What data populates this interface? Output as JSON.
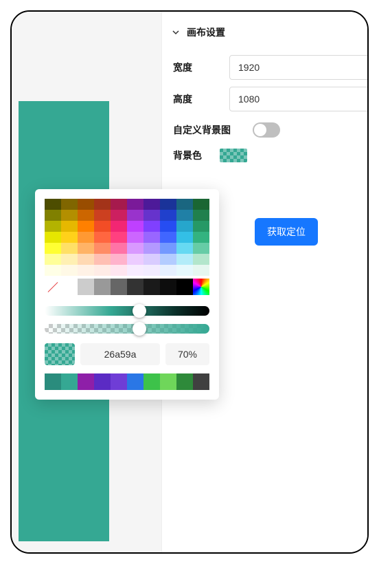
{
  "panel": {
    "title": "画布设置",
    "width_label": "宽度",
    "width_value": "1920",
    "height_label": "高度",
    "height_value": "1080",
    "custom_bg_label": "自定义背景图",
    "bg_color_label": "背景色",
    "get_position_label": "获取定位"
  },
  "picker": {
    "hex": "26a59a",
    "alpha": "70%"
  },
  "palette": {
    "main": [
      [
        "#4d4d00",
        "#806600",
        "#994d00",
        "#a33319",
        "#a61a4d",
        "#7a1a99",
        "#4d1a99",
        "#1a3399",
        "#1a6680",
        "#1a6633"
      ],
      [
        "#808000",
        "#b38f00",
        "#cc6600",
        "#cc4020",
        "#cc2060",
        "#9933cc",
        "#6633cc",
        "#2040cc",
        "#2080a6",
        "#20804d"
      ],
      [
        "#b3b300",
        "#e6b800",
        "#ff8000",
        "#f24d26",
        "#f22673",
        "#bf40ff",
        "#8040ff",
        "#264df2",
        "#26a6cc",
        "#269966"
      ],
      [
        "#e6e600",
        "#ffd11a",
        "#ff9933",
        "#ff6640",
        "#ff4080",
        "#cc66ff",
        "#9966ff",
        "#4066ff",
        "#33bfe6",
        "#33b380"
      ],
      [
        "#ffff33",
        "#ffe066",
        "#ffb366",
        "#ff8c66",
        "#ff73a6",
        "#d999ff",
        "#b399ff",
        "#7399ff",
        "#66d9f2",
        "#66cca6"
      ],
      [
        "#ffff99",
        "#fff0b3",
        "#ffd9b3",
        "#ffbfb3",
        "#ffb3cc",
        "#ecccff",
        "#d9ccff",
        "#b3ccff",
        "#b3ecf9",
        "#b3e6cc"
      ],
      [
        "#ffffe6",
        "#fff9e6",
        "#fff2e6",
        "#ffece6",
        "#ffe6f0",
        "#f7ecff",
        "#f2ecff",
        "#e6f0ff",
        "#e6f9fd",
        "#e6f7f0"
      ]
    ],
    "bottom": [
      "none",
      "#ffffff",
      "#cccccc",
      "#999999",
      "#666666",
      "#333333",
      "#1a1a1a",
      "#0d0d0d",
      "#000000",
      "rainbow"
    ]
  },
  "recent": [
    "#2a8c7d",
    "#35a893",
    "#8e1fa8",
    "#5b2bc4",
    "#6f3dd6",
    "#2a77e6",
    "#3dc24a",
    "#6fd65a",
    "#2e8a3a",
    "#404040"
  ]
}
